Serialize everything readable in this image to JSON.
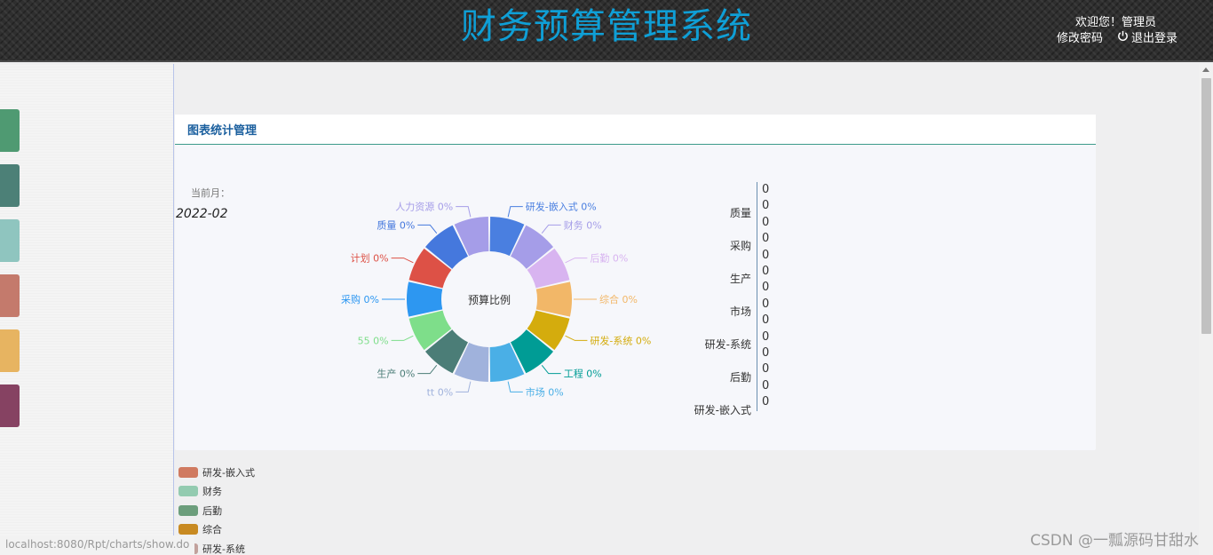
{
  "header": {
    "title": "财务预算管理系统",
    "welcome": "欢迎您！管理员",
    "change_password": "修改密码",
    "logout": "退出登录"
  },
  "sidebar": {
    "tabs": [
      {
        "color": "#4f9a72"
      },
      {
        "color": "#4c8077"
      },
      {
        "color": "#8fc5bf"
      },
      {
        "color": "#c47a6c"
      },
      {
        "color": "#e7b461"
      },
      {
        "color": "#864262"
      }
    ]
  },
  "panel": {
    "title": "图表统计管理",
    "month_label": "当前月：",
    "month_value": "2022-02"
  },
  "chart_data": {
    "type": "pie",
    "title": "预算比例",
    "slices": [
      {
        "label": "研发-嵌入式 0%",
        "value": 1,
        "color": "#4a7fe0"
      },
      {
        "label": "财务 0%",
        "value": 1,
        "color": "#a59de8"
      },
      {
        "label": "后勤 0%",
        "value": 1,
        "color": "#d8b4f0"
      },
      {
        "label": "综合 0%",
        "value": 1,
        "color": "#f2b768"
      },
      {
        "label": "研发-系统 0%",
        "value": 1,
        "color": "#d4ac0d"
      },
      {
        "label": "工程 0%",
        "value": 1,
        "color": "#009c95"
      },
      {
        "label": "市场 0%",
        "value": 1,
        "color": "#4aafe6"
      },
      {
        "label": "tt 0%",
        "value": 1,
        "color": "#a0b2dc"
      },
      {
        "label": "生产 0%",
        "value": 1,
        "color": "#4b7d77"
      },
      {
        "label": "55 0%",
        "value": 1,
        "color": "#7ede8a"
      },
      {
        "label": "采购 0%",
        "value": 1,
        "color": "#2d97f1"
      },
      {
        "label": "计划 0%",
        "value": 1,
        "color": "#dd5146"
      },
      {
        "label": "质量 0%",
        "value": 1,
        "color": "#4578dd"
      },
      {
        "label": "人力资源 0%",
        "value": 1,
        "color": "#a59de8"
      }
    ]
  },
  "axis_list": {
    "numbers": [
      "0",
      "0",
      "0",
      "0",
      "0",
      "0",
      "0",
      "0",
      "0",
      "0",
      "0",
      "0",
      "0",
      "0"
    ],
    "categories": [
      "质量",
      "采购",
      "生产",
      "市场",
      "研发-系统",
      "后勤",
      "研发-嵌入式"
    ]
  },
  "legend": [
    {
      "label": "研发-嵌入式",
      "color": "#d07a60"
    },
    {
      "label": "财务",
      "color": "#93cbb0"
    },
    {
      "label": "后勤",
      "color": "#6c9e7c"
    },
    {
      "label": "综合",
      "color": "#c88a22"
    },
    {
      "label": "研发-系统",
      "color": "#c2a19c"
    }
  ],
  "status_url": "localhost:8080/Rpt/charts/show.do",
  "watermark": "CSDN @一瓢源码甘甜水"
}
